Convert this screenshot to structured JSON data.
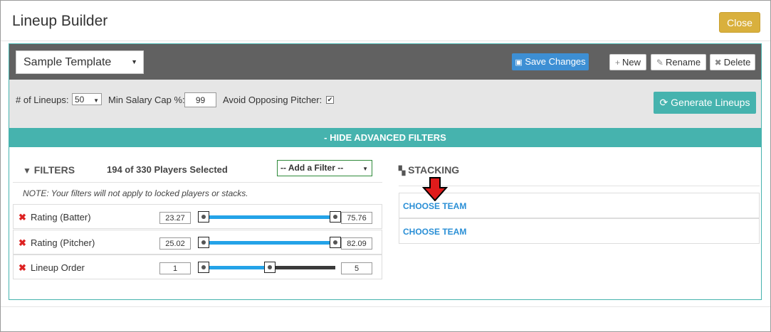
{
  "modal": {
    "title": "Lineup Builder",
    "close_label": "Close"
  },
  "template": {
    "selected": "Sample Template"
  },
  "toolbar": {
    "save_label": "Save Changes",
    "new_label": "New",
    "rename_label": "Rename",
    "delete_label": "Delete"
  },
  "options": {
    "lineups_label": "# of Lineups:",
    "lineups_value": "50",
    "salary_label": "Min Salary Cap %:",
    "salary_value": "99",
    "pitcher_label": "Avoid Opposing Pitcher:",
    "pitcher_checked": true,
    "generate_label": "Generate Lineups"
  },
  "advanced": {
    "toggle_label": "- HIDE ADVANCED FILTERS"
  },
  "filters": {
    "title": "FILTERS",
    "selected_text": "194 of 330 Players Selected",
    "add_filter_placeholder": "-- Add a Filter --",
    "note": "NOTE: Your filters will not apply to locked players or stacks.",
    "rows": [
      {
        "label": "Rating (Batter)",
        "min": "23.27",
        "max": "75.76",
        "range_lo": 0,
        "range_hi": 1
      },
      {
        "label": "Rating (Pitcher)",
        "min": "25.02",
        "max": "82.09",
        "range_lo": 0,
        "range_hi": 1
      },
      {
        "label": "Lineup Order",
        "min": "1",
        "max": "5",
        "range_lo": 0,
        "range_hi": 0.5
      }
    ]
  },
  "stacking": {
    "title": "STACKING",
    "teams": [
      "CHOOSE TEAM",
      "CHOOSE TEAM"
    ]
  },
  "colors": {
    "accent": "#46b3ae",
    "primary": "#3d8fd4",
    "close": "#d9b03d",
    "slider_fill": "#24a3e8",
    "arrow": "#e01b1b"
  }
}
